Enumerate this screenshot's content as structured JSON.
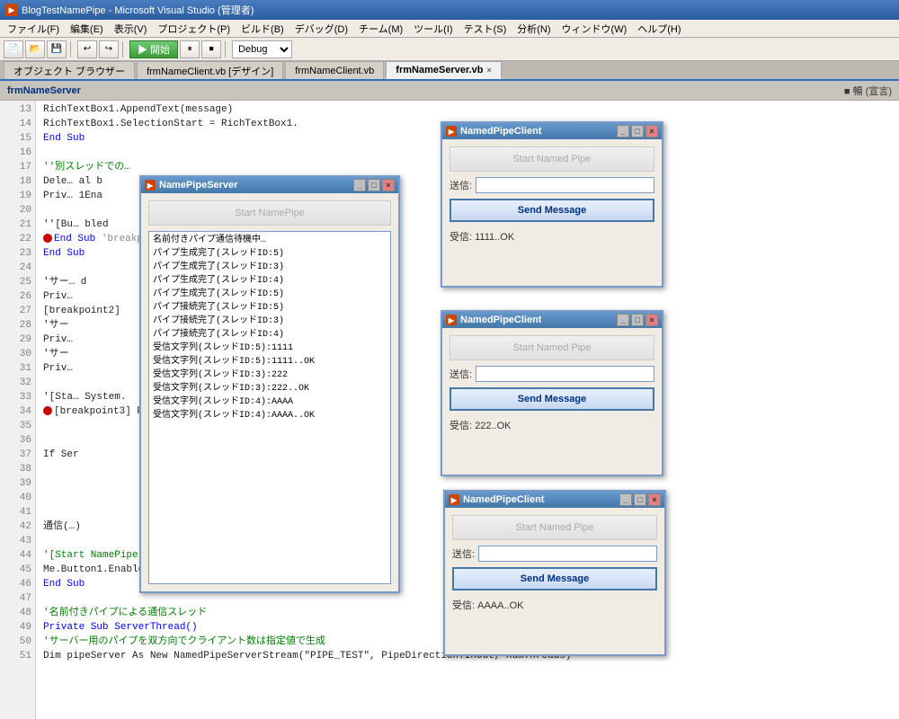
{
  "titleBar": {
    "title": "BlogTestNamePipe - Microsoft Visual Studio (管理者)"
  },
  "menuBar": {
    "items": [
      {
        "label": "ファイル(F)"
      },
      {
        "label": "編集(E)"
      },
      {
        "label": "表示(V)"
      },
      {
        "label": "プロジェクト(P)"
      },
      {
        "label": "ビルド(B)"
      },
      {
        "label": "デバッグ(D)"
      },
      {
        "label": "チーム(M)"
      },
      {
        "label": "ツール(I)"
      },
      {
        "label": "テスト(S)"
      },
      {
        "label": "分析(N)"
      },
      {
        "label": "ウィンドウ(W)"
      },
      {
        "label": "ヘルプ(H)"
      }
    ]
  },
  "toolbar": {
    "debugLabel": "Debug",
    "runLabel": "▶ 開始"
  },
  "tabs": {
    "objectBrowser": "オブジェクト ブラウザー",
    "designTab": "frmNameClient.vb [デザイン]",
    "codeTab1": "frmNameClient.vb",
    "activeTab": "frmNameServer.vb",
    "closeBtn": "×"
  },
  "subHeader": {
    "title": "frmNameServer",
    "rightLabel": "■ 暢 (宣言)"
  },
  "codeLines": [
    {
      "num": "13",
      "text": "            RichTextBox1.AppendText(message)"
    },
    {
      "num": "14",
      "text": "            RichTextBox1.SelectionStart = RichTextBox1."
    },
    {
      "num": "15",
      "text": "        End Sub",
      "type": "kw_end"
    },
    {
      "num": "16",
      "text": ""
    },
    {
      "num": "17",
      "text": "        ''別スレッドでの…"
    },
    {
      "num": "18",
      "text": "        Dele…                     al b"
    },
    {
      "num": "19",
      "text": "        Priv…                    1Ena"
    },
    {
      "num": "20",
      "text": ""
    },
    {
      "num": "21",
      "text": "        ''[Bu…                   bled"
    },
    {
      "num": "22",
      "text": "        [breakpoint]"
    },
    {
      "num": "23",
      "text": "        End Sub",
      "type": "kw_end"
    },
    {
      "num": "24",
      "text": ""
    },
    {
      "num": "25",
      "text": "        'サー…                   d"
    },
    {
      "num": "26",
      "text": "        Priv…"
    },
    {
      "num": "27",
      "text": "        [breakpoint2]"
    },
    {
      "num": "28",
      "text": "        'サー"
    },
    {
      "num": "29",
      "text": "        Priv…"
    },
    {
      "num": "30",
      "text": "        'サー"
    },
    {
      "num": "31",
      "text": "        Priv…"
    },
    {
      "num": "32",
      "text": ""
    },
    {
      "num": "33",
      "text": "        '[Sta…               System."
    },
    {
      "num": "34",
      "text": "[breakpoint3]   Priv…                  tArgs) _"
    },
    {
      "num": "35",
      "text": ""
    },
    {
      "num": "36",
      "text": ""
    },
    {
      "num": "37",
      "text": "                                          If Ser"
    },
    {
      "num": "38",
      "text": ""
    },
    {
      "num": "39",
      "text": ""
    },
    {
      "num": "40",
      "text": ""
    },
    {
      "num": "41",
      "text": ""
    },
    {
      "num": "42",
      "text": "                                    通信(…)"
    },
    {
      "num": "43",
      "text": ""
    },
    {
      "num": "44",
      "text": "        '[Start NamePipe]ボタン不可設定"
    },
    {
      "num": "45",
      "text": "        Me.Button1.Enabled = False",
      "hasKw": true
    },
    {
      "num": "46",
      "text": "        End Sub",
      "type": "kw_end"
    },
    {
      "num": "47",
      "text": ""
    },
    {
      "num": "48",
      "text": "        '名前付きパイプによる通信スレッド"
    },
    {
      "num": "49",
      "text": "        Private Sub ServerThread()"
    },
    {
      "num": "50",
      "text": "            'サーバー用のパイプを双方向でクライアント数は指定値で生成"
    },
    {
      "num": "51",
      "text": "            Dim pipeServer As New NamedPipeServerStream(\"PIPE_TEST\", PipeDirection.InOut, numThreads)"
    }
  ],
  "serverWindow": {
    "title": "NamePipeServer",
    "btnLabel": "Start NamePipe",
    "logLines": [
      "名前付きパイプ通信待機中…",
      "パイプ生成完了(スレッドID:5)",
      "パイプ生成完了(スレッドID:3)",
      "パイプ生成完了(スレッドID:4)",
      "パイプ生成完了(スレッドID:5)",
      "パイプ接続完了(スレッドID:5)",
      "パイプ接続完了(スレッドID:3)",
      "パイプ接続完了(スレッドID:4)",
      "受信文字列(スレッドID:5):1111",
      "受信文字列(スレッドID:5):1111..OK",
      "受信文字列(スレッドID:3):222",
      "受信文字列(スレッドID:3):222..OK",
      "受信文字列(スレッドID:4):AAAA",
      "受信文字列(スレッドID:4):AAAA..OK"
    ]
  },
  "clientWindows": [
    {
      "title": "NamedPipeClient",
      "startBtnLabel": "Start Named Pipe",
      "sendLabel": "送信:",
      "sendValue": "",
      "sendBtnLabel": "Send Message",
      "recvLabel": "受信:",
      "recvValue": "1111..OK",
      "startBtnDisabled": true
    },
    {
      "title": "NamedPipeClient",
      "startBtnLabel": "Start Named Pipe",
      "sendLabel": "送信:",
      "sendValue": "",
      "sendBtnLabel": "Send Message",
      "recvLabel": "受信:",
      "recvValue": "222..OK",
      "startBtnDisabled": true
    },
    {
      "title": "NamedPipeClient",
      "startBtnLabel": "Start Named Pipe",
      "sendLabel": "送信:",
      "sendValue": "",
      "sendBtnLabel": "Send Message",
      "recvLabel": "受信:",
      "recvValue": "AAAA..OK",
      "startBtnDisabled": true
    }
  ]
}
